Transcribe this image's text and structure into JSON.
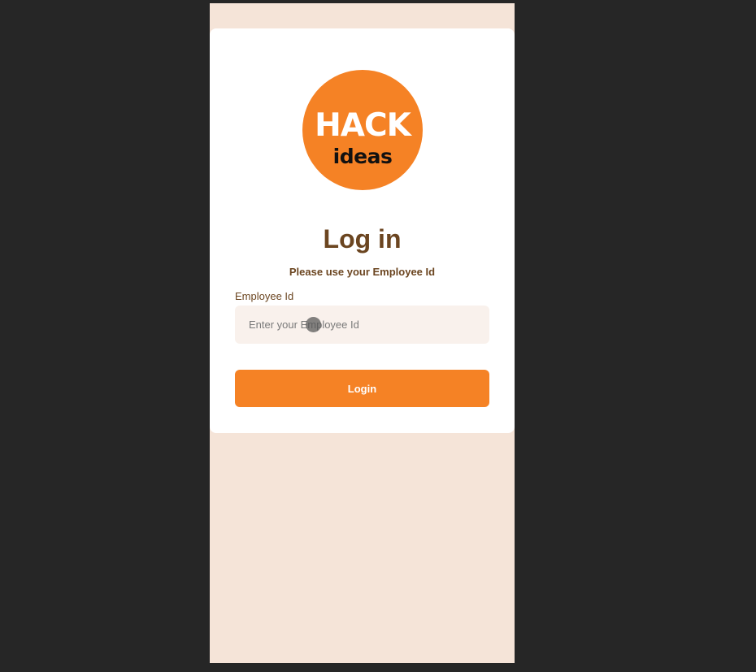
{
  "logo": {
    "line1": "HACK",
    "line2": "ideas",
    "color": "#f58225"
  },
  "login": {
    "title": "Log in",
    "subtitle": "Please use your Employee Id",
    "employee_id_label": "Employee Id",
    "employee_id_placeholder": "Enter your Employee Id",
    "employee_id_value": "",
    "submit_label": "Login"
  },
  "colors": {
    "accent": "#f58225",
    "text_brown": "#6b4520",
    "background": "#f5e4d8",
    "input_background": "#f9f1ec"
  }
}
